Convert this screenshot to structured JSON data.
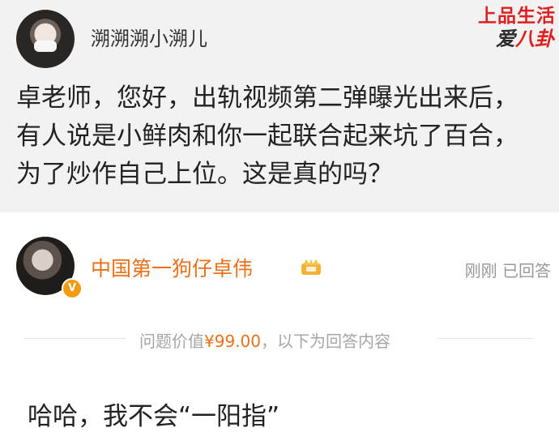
{
  "question": {
    "asker_name": "溯溯溯小溯儿",
    "text": "卓老师，您好，出轨视频第二弹曝光出来后，有人说是小鲜肉和你一起联合起来坑了百合，为了炒作自己上位。这是真的吗？"
  },
  "logo": {
    "top_text": "上品生活",
    "bottom_text_a": "爱",
    "bottom_text_b": "八卦"
  },
  "answer": {
    "answerer_name": "中国第一狗仔卓伟",
    "status": "刚刚 已回答",
    "divider_prefix": "问题价值",
    "price": "¥99.00",
    "divider_suffix": "，以下为回答内容",
    "text": "哈哈，我不会“一阳指”"
  },
  "colors": {
    "name_orange": "#e8711a",
    "logo_red": "#e02020",
    "question_bg": "#f2f2f2"
  },
  "icons": [
    "avatar",
    "verified-badge-icon",
    "crown-icon"
  ]
}
